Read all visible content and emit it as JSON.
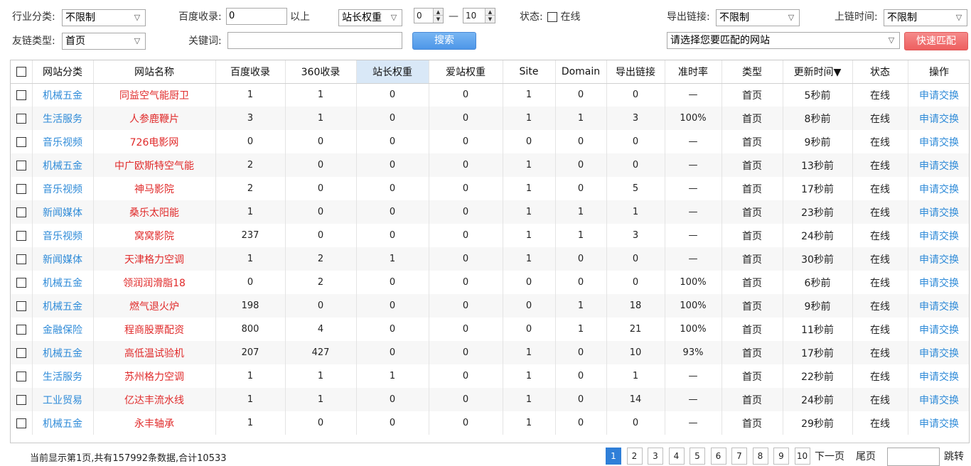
{
  "filters": {
    "industry_label": "行业分类:",
    "industry_value": "不限制",
    "baidu_label": "百度收录:",
    "baidu_value": "0",
    "baidu_suffix": "以上",
    "weight_select": "站长权重",
    "range_min": "0",
    "range_sep": "—",
    "range_max": "10",
    "status_label": "状态:",
    "status_option": "在线",
    "export_label": "导出链接:",
    "export_value": "不限制",
    "linktime_label": "上链时间:",
    "linktime_value": "不限制",
    "linktype_label": "友链类型:",
    "linktype_value": "首页",
    "keyword_label": "关键词:",
    "keyword_value": "",
    "search_button": "搜索",
    "match_select": "请选择您要匹配的网站",
    "match_button": "快速匹配"
  },
  "table": {
    "headers": [
      "网站分类",
      "网站名称",
      "百度收录",
      "360收录",
      "站长权重",
      "爱站权重",
      "Site",
      "Domain",
      "导出链接",
      "准时率",
      "类型",
      "更新时间▼",
      "状态",
      "操作"
    ],
    "rows": [
      [
        "机械五金",
        "同益空气能厨卫",
        "1",
        "1",
        "0",
        "0",
        "1",
        "0",
        "0",
        "—",
        "首页",
        "5秒前",
        "在线",
        "申请交换"
      ],
      [
        "生活服务",
        "人参鹿鞭片",
        "3",
        "1",
        "0",
        "0",
        "1",
        "1",
        "3",
        "100%",
        "首页",
        "8秒前",
        "在线",
        "申请交换"
      ],
      [
        "音乐视频",
        "726电影网",
        "0",
        "0",
        "0",
        "0",
        "0",
        "0",
        "0",
        "—",
        "首页",
        "9秒前",
        "在线",
        "申请交换"
      ],
      [
        "机械五金",
        "中广欧斯特空气能",
        "2",
        "0",
        "0",
        "0",
        "1",
        "0",
        "0",
        "—",
        "首页",
        "13秒前",
        "在线",
        "申请交换"
      ],
      [
        "音乐视频",
        "神马影院",
        "2",
        "0",
        "0",
        "0",
        "1",
        "0",
        "5",
        "—",
        "首页",
        "17秒前",
        "在线",
        "申请交换"
      ],
      [
        "新闻媒体",
        "桑乐太阳能",
        "1",
        "0",
        "0",
        "0",
        "1",
        "1",
        "1",
        "—",
        "首页",
        "23秒前",
        "在线",
        "申请交换"
      ],
      [
        "音乐视频",
        "窝窝影院",
        "237",
        "0",
        "0",
        "0",
        "1",
        "1",
        "3",
        "—",
        "首页",
        "24秒前",
        "在线",
        "申请交换"
      ],
      [
        "新闻媒体",
        "天津格力空调",
        "1",
        "2",
        "1",
        "0",
        "1",
        "0",
        "0",
        "—",
        "首页",
        "30秒前",
        "在线",
        "申请交换"
      ],
      [
        "机械五金",
        "领润润滑脂18",
        "0",
        "2",
        "0",
        "0",
        "0",
        "0",
        "0",
        "100%",
        "首页",
        "6秒前",
        "在线",
        "申请交换"
      ],
      [
        "机械五金",
        "燃气退火炉",
        "198",
        "0",
        "0",
        "0",
        "0",
        "1",
        "18",
        "100%",
        "首页",
        "9秒前",
        "在线",
        "申请交换"
      ],
      [
        "金融保险",
        "程商股票配资",
        "800",
        "4",
        "0",
        "0",
        "0",
        "1",
        "21",
        "100%",
        "首页",
        "11秒前",
        "在线",
        "申请交换"
      ],
      [
        "机械五金",
        "高低温试验机",
        "207",
        "427",
        "0",
        "0",
        "1",
        "0",
        "10",
        "93%",
        "首页",
        "17秒前",
        "在线",
        "申请交换"
      ],
      [
        "生活服务",
        "苏州格力空调",
        "1",
        "1",
        "1",
        "0",
        "1",
        "0",
        "1",
        "—",
        "首页",
        "22秒前",
        "在线",
        "申请交换"
      ],
      [
        "工业贸易",
        "亿达丰流水线",
        "1",
        "1",
        "0",
        "0",
        "1",
        "0",
        "14",
        "—",
        "首页",
        "24秒前",
        "在线",
        "申请交换"
      ],
      [
        "机械五金",
        "永丰轴承",
        "1",
        "0",
        "0",
        "0",
        "1",
        "0",
        "0",
        "—",
        "首页",
        "29秒前",
        "在线",
        "申请交换"
      ]
    ]
  },
  "footer": {
    "summary": "当前显示第1页,共有157992条数据,合计10533",
    "pages": [
      "1",
      "2",
      "3",
      "4",
      "5",
      "6",
      "7",
      "8",
      "9",
      "10"
    ],
    "current_page": "1",
    "next": "下一页",
    "last": "尾页",
    "jump": "跳转"
  },
  "icons": {
    "dropdown": "chevron-down-icon",
    "spin": "spin-arrows-icon"
  },
  "colors": {
    "link_blue": "#2f8bd8",
    "name_red": "#e02a2a",
    "search_button": "#4d96e8",
    "match_button": "#ee5f5f",
    "active_header": "#d9e8f7",
    "current_page": "#2f7fd8"
  }
}
